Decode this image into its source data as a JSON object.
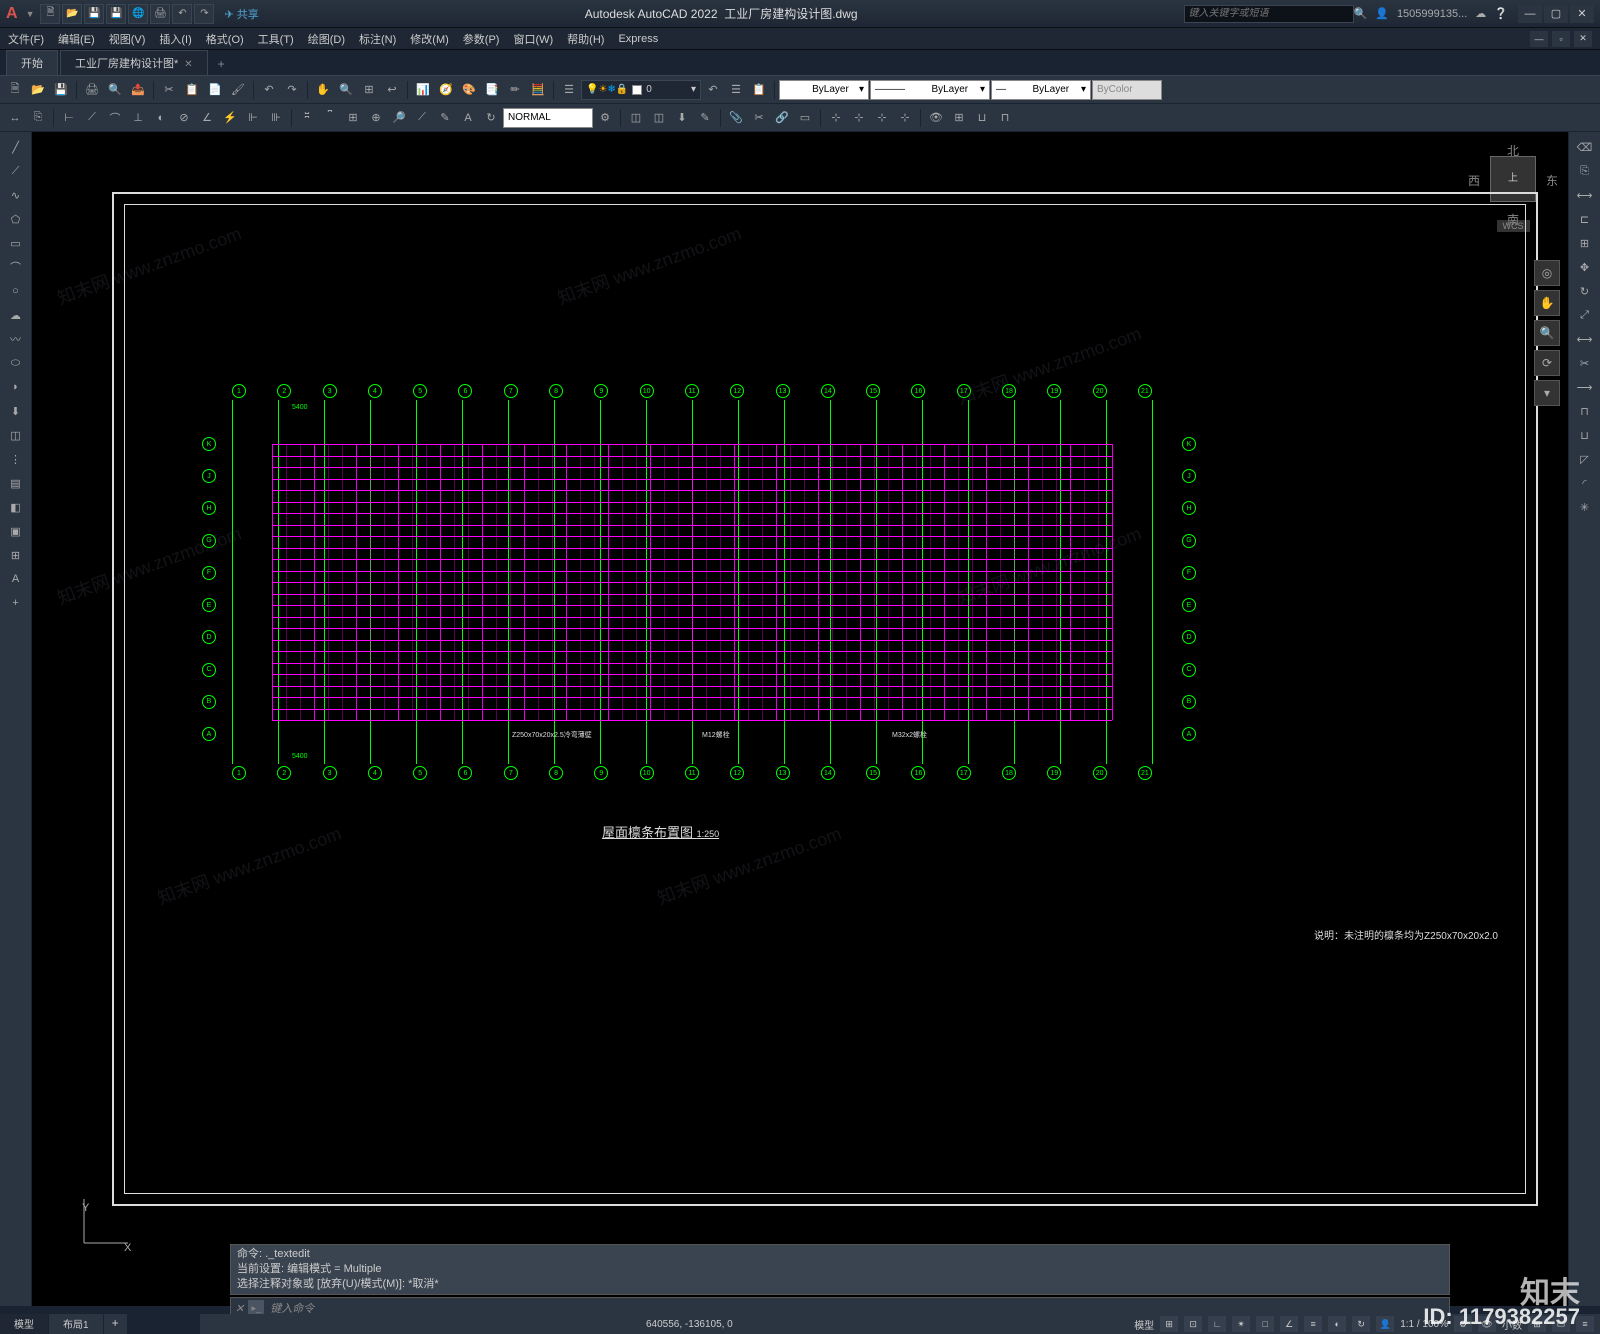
{
  "title": {
    "app": "Autodesk AutoCAD 2022",
    "file": "工业厂房建构设计图.dwg",
    "account": "1505999135...",
    "search_ph": "键入关键字或短语"
  },
  "share": "共享",
  "menu": [
    "文件(F)",
    "编辑(E)",
    "视图(V)",
    "插入(I)",
    "格式(O)",
    "工具(T)",
    "绘图(D)",
    "标注(N)",
    "修改(M)",
    "参数(P)",
    "窗口(W)",
    "帮助(H)",
    "Express"
  ],
  "tabs": {
    "start": "开始",
    "doc": "工业厂房建构设计图*"
  },
  "props": {
    "layer_zero": "0",
    "bylayer": "ByLayer",
    "bycolor": "ByColor",
    "normal": "NORMAL"
  },
  "viewcube": {
    "n": "北",
    "s": "南",
    "e": "东",
    "w": "西",
    "top": "上",
    "wcs": "WCS"
  },
  "cmd": {
    "hist1": "命令: ._textedit",
    "hist2": "当前设置: 编辑模式 = Multiple",
    "hist3": "选择注释对象或 [放弃(U)/模式(M)]: *取消*",
    "prompt": "键入命令"
  },
  "layout": {
    "model": "模型",
    "layout1": "布局1"
  },
  "status": {
    "coord": "640556, -136105, 0",
    "model": "模型",
    "scale": "1:1 / 100%",
    "dec": "小数"
  },
  "drawing": {
    "title": "屋面檩条布置图",
    "scale": "1:250",
    "note": "说明：未注明的檩条均为Z250x70x20x2.0",
    "detail1": "Z250x70x20x2.5冷弯薄壁",
    "detail2": "M12螺栓",
    "detail3": "M32x2螺栓",
    "col_bubbles": [
      "1",
      "2",
      "3",
      "4",
      "5",
      "6",
      "7",
      "8",
      "9",
      "10",
      "11",
      "12",
      "13",
      "14",
      "15",
      "16",
      "17",
      "18",
      "19",
      "20",
      "21"
    ],
    "row_bubbles": [
      "K",
      "J",
      "H",
      "G",
      "F",
      "E",
      "D",
      "C",
      "B",
      "A"
    ],
    "dim": "5400"
  },
  "watermark": {
    "site": "知末网 www.znzmo.com",
    "logo": "知末",
    "id": "ID: 1179382257"
  }
}
